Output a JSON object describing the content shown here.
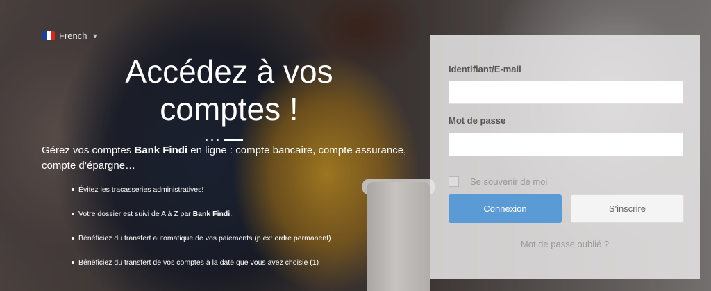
{
  "language": {
    "label": "French",
    "flag_colors": [
      "#1f3f8f",
      "#ffffff",
      "#d52b1e"
    ]
  },
  "hero": {
    "title": "Accédez à vos comptes !",
    "description_pre": "Gérez vos comptes ",
    "description_brand": "Bank Findi",
    "description_post": " en ligne : compte bancaire, compte assurance, compte d’épargne…",
    "bullets": [
      {
        "text": "Évitez les tracasseries administratives!"
      },
      {
        "text": "Votre dossier est suivi de A à Z par ",
        "brand": "Bank Findi",
        "suffix": "."
      },
      {
        "text": "Bénéficiez du transfert automatique de vos paiements (p.ex: ordre permanent)"
      },
      {
        "text": "Bénéficiez du transfert de vos comptes à la date que vous avez choisie (1)"
      }
    ]
  },
  "login": {
    "username_label": "Identifiant/E-mail",
    "username_value": "",
    "password_label": "Mot de passe",
    "password_value": "",
    "remember_label": "Se souvenir de moi",
    "login_button": "Connexion",
    "register_button": "S'inscrire",
    "forgot_link": "Mot de passe oublié ?",
    "primary_color": "#5a9bd5"
  }
}
